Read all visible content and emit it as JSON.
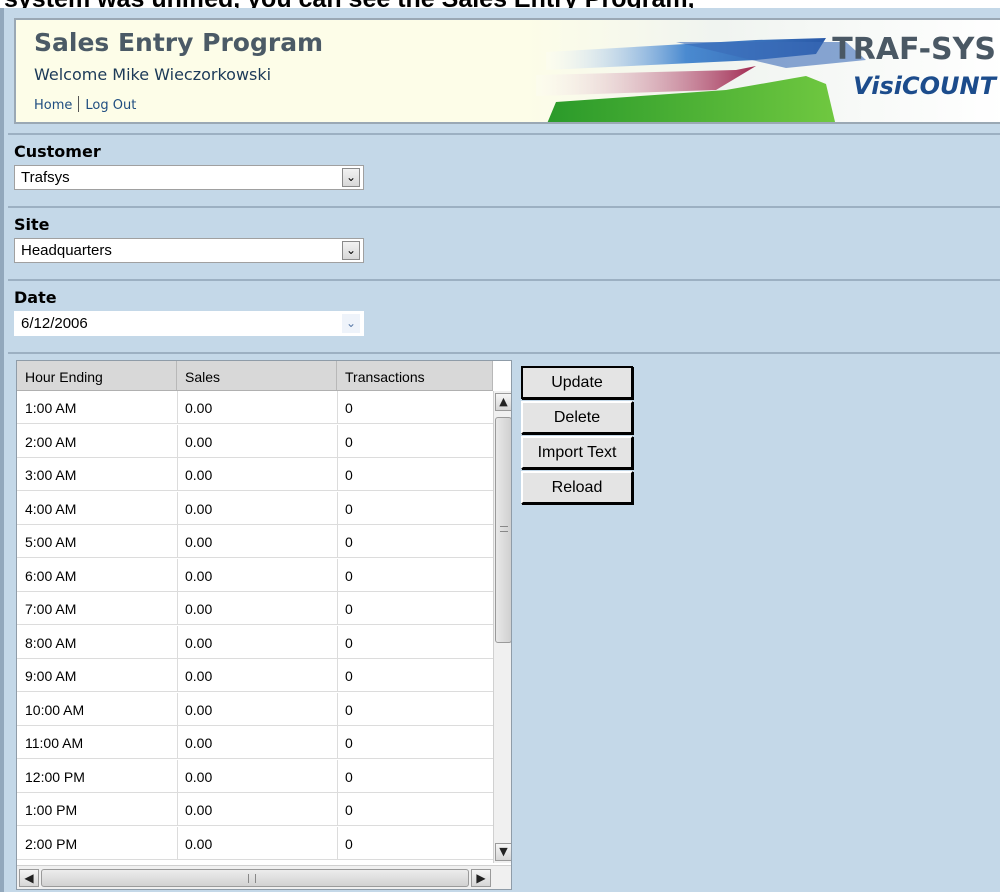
{
  "clipped_caption": "system was unified, you can see the Sales Entry Program,",
  "header": {
    "title": "Sales Entry Program",
    "welcome": "Welcome Mike Wieczorkowski",
    "nav": [
      {
        "label": "Home"
      },
      {
        "label": "Log Out"
      }
    ],
    "logo": {
      "line1": "TRAF-SYS",
      "line2": "VisiCOUNT"
    }
  },
  "customer": {
    "label": "Customer",
    "value": "Trafsys"
  },
  "site": {
    "label": "Site",
    "value": "Headquarters"
  },
  "date": {
    "label": "Date",
    "value": "6/12/2006"
  },
  "grid": {
    "columns": [
      "Hour Ending",
      "Sales",
      "Transactions"
    ],
    "rows": [
      [
        "1:00 AM",
        "0.00",
        "0"
      ],
      [
        "2:00 AM",
        "0.00",
        "0"
      ],
      [
        "3:00 AM",
        "0.00",
        "0"
      ],
      [
        "4:00 AM",
        "0.00",
        "0"
      ],
      [
        "5:00 AM",
        "0.00",
        "0"
      ],
      [
        "6:00 AM",
        "0.00",
        "0"
      ],
      [
        "7:00 AM",
        "0.00",
        "0"
      ],
      [
        "8:00 AM",
        "0.00",
        "0"
      ],
      [
        "9:00 AM",
        "0.00",
        "0"
      ],
      [
        "10:00 AM",
        "0.00",
        "0"
      ],
      [
        "11:00 AM",
        "0.00",
        "0"
      ],
      [
        "12:00 PM",
        "0.00",
        "0"
      ],
      [
        "1:00 PM",
        "0.00",
        "0"
      ],
      [
        "2:00 PM",
        "0.00",
        "0"
      ]
    ]
  },
  "actions": {
    "update": "Update",
    "delete": "Delete",
    "import": "Import Text",
    "reload": "Reload"
  },
  "icons": {
    "dropdown": "chevron-down-icon",
    "scroll_up": "arrow-up-icon",
    "scroll_down": "arrow-down-icon",
    "scroll_left": "arrow-left-icon",
    "scroll_right": "arrow-right-icon"
  }
}
